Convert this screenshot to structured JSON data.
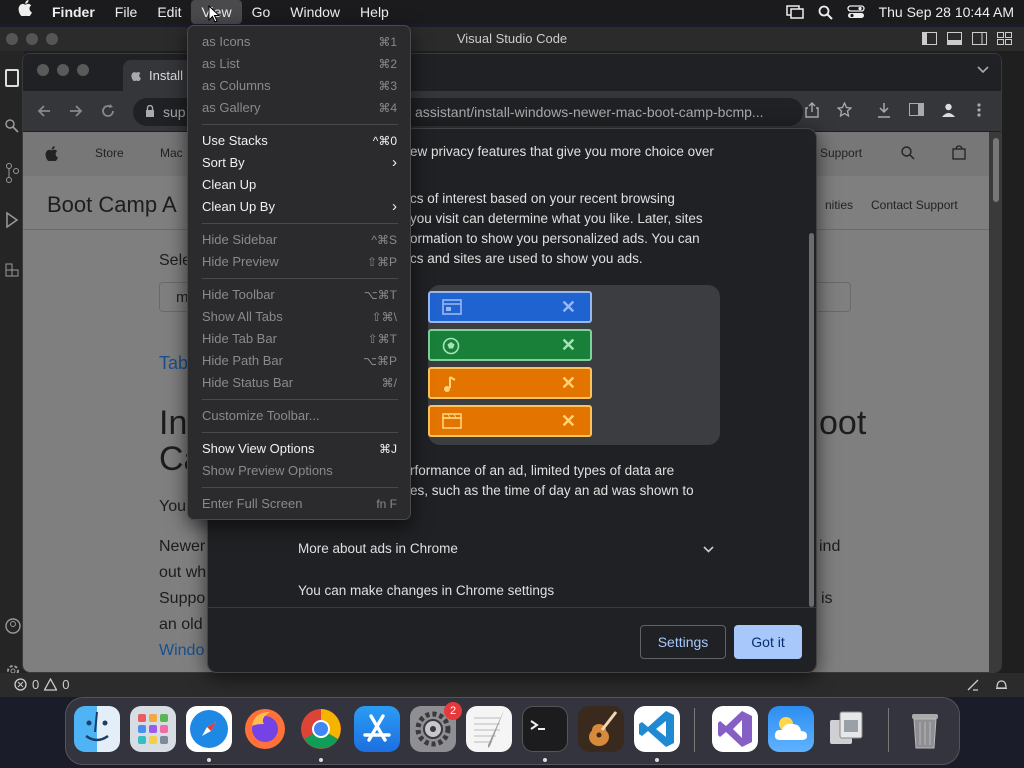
{
  "menubar": {
    "apple": "",
    "app": "Finder",
    "items": [
      "File",
      "Edit",
      "View",
      "Go",
      "Window",
      "Help"
    ],
    "datetime": "Thu Sep 28  10:44 AM"
  },
  "vscode": {
    "title": "Visual Studio Code",
    "status_errors": "0",
    "status_warnings": "0"
  },
  "chrome": {
    "tab_title": "Install",
    "url": "support.apple.com/guide/bootcamp-assistant/install-windows-newer-mac-boot-camp-bcmp...",
    "url_visible": "sup",
    "url_rest": "assistant/install-windows-newer-mac-boot-camp-bcmp..."
  },
  "apple_page": {
    "nav": [
      "Store",
      "Mac",
      "Support"
    ],
    "subnav_title": "Boot Camp A",
    "subnav_right": [
      "nities",
      "Contact Support"
    ],
    "select_label": "Sele",
    "input_value": "m",
    "tab_link": "Tab",
    "heading_1": "In",
    "heading_2": "Ca",
    "heading_right": "oot",
    "para_you": "You",
    "para_lines": [
      "Newer",
      "out wh",
      "Suppo",
      "an old"
    ],
    "para_right": [
      "ind",
      "is"
    ],
    "link": "Windo"
  },
  "privacy_popup": {
    "line_1": "ew privacy features that give you more choice over",
    "para_2": [
      "cs of interest based on your recent browsing",
      "you visit can determine what you like. Later, sites",
      "ormation to show you personalized ads. You can",
      "cs and sites are used to show you ads."
    ],
    "para_3": [
      "rformance of an ad, limited types of data are",
      "es, such as the time of day an ad was shown to"
    ],
    "more_about": "More about ads in Chrome",
    "changes": "You can make changes in Chrome settings",
    "settings_btn": "Settings",
    "gotit_btn": "Got it",
    "chip_colors": [
      "#1f63d1",
      "#188038",
      "#e37400",
      "#e37400"
    ]
  },
  "view_menu": {
    "items": [
      {
        "label": "as Icons",
        "shortcut": "⌘1",
        "disabled": true
      },
      {
        "label": "as List",
        "shortcut": "⌘2",
        "disabled": true
      },
      {
        "label": "as Columns",
        "shortcut": "⌘3",
        "disabled": true
      },
      {
        "label": "as Gallery",
        "shortcut": "⌘4",
        "disabled": true
      },
      {
        "label": "Use Stacks",
        "shortcut": "^⌘0",
        "disabled": false
      },
      {
        "label": "Sort By",
        "shortcut": "",
        "disabled": false
      },
      {
        "label": "Clean Up",
        "shortcut": "",
        "disabled": false
      },
      {
        "label": "Clean Up By",
        "shortcut": "",
        "disabled": false
      },
      {
        "label": "Hide Sidebar",
        "shortcut": "^⌘S",
        "disabled": true
      },
      {
        "label": "Hide Preview",
        "shortcut": "⇧⌘P",
        "disabled": true
      },
      {
        "label": "Hide Toolbar",
        "shortcut": "⌥⌘T",
        "disabled": true
      },
      {
        "label": "Show All Tabs",
        "shortcut": "⇧⌘\\",
        "disabled": true
      },
      {
        "label": "Hide Tab Bar",
        "shortcut": "⇧⌘T",
        "disabled": true
      },
      {
        "label": "Hide Path Bar",
        "shortcut": "⌥⌘P",
        "disabled": true
      },
      {
        "label": "Hide Status Bar",
        "shortcut": "⌘/",
        "disabled": true
      },
      {
        "label": "Customize Toolbar...",
        "shortcut": "",
        "disabled": true
      },
      {
        "label": "Show View Options",
        "shortcut": "⌘J",
        "disabled": false
      },
      {
        "label": "Show Preview Options",
        "shortcut": "",
        "disabled": true
      },
      {
        "label": "Enter Full Screen",
        "shortcut": "fn F",
        "disabled": true
      }
    ]
  },
  "dock": {
    "apps": [
      "Finder",
      "Launchpad",
      "Safari",
      "Firefox",
      "Chrome",
      "App Store",
      "System Settings",
      "TextEdit",
      "Terminal",
      "GarageBand",
      "Visual Studio Code",
      "Visual Studio",
      "Cloud",
      "Migration Assistant",
      "Trash"
    ],
    "settings_badge": "2"
  }
}
